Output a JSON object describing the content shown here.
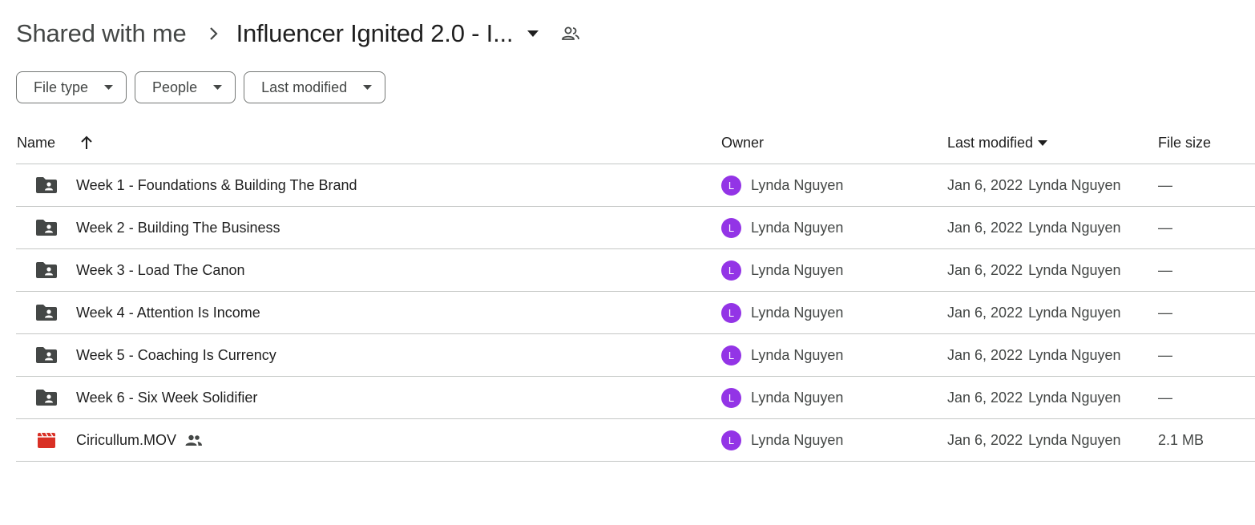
{
  "breadcrumb": {
    "root": "Shared with me",
    "current": "Influencer Ignited 2.0 - I..."
  },
  "filters": [
    {
      "label": "File type"
    },
    {
      "label": "People"
    },
    {
      "label": "Last modified"
    }
  ],
  "table": {
    "headers": {
      "name": "Name",
      "owner": "Owner",
      "last_modified": "Last modified",
      "file_size": "File size"
    },
    "rows": [
      {
        "type": "shared-folder",
        "name": "Week 1 - Foundations & Building The Brand",
        "owner_initial": "L",
        "owner": "Lynda Nguyen",
        "modified": "Jan 6, 2022",
        "modified_by": "Lynda Nguyen",
        "size": "—"
      },
      {
        "type": "shared-folder",
        "name": "Week 2 - Building The Business",
        "owner_initial": "L",
        "owner": "Lynda Nguyen",
        "modified": "Jan 6, 2022",
        "modified_by": "Lynda Nguyen",
        "size": "—"
      },
      {
        "type": "shared-folder",
        "name": "Week 3 - Load The Canon",
        "owner_initial": "L",
        "owner": "Lynda Nguyen",
        "modified": "Jan 6, 2022",
        "modified_by": "Lynda Nguyen",
        "size": "—"
      },
      {
        "type": "shared-folder",
        "name": "Week 4 - Attention Is Income",
        "owner_initial": "L",
        "owner": "Lynda Nguyen",
        "modified": "Jan 6, 2022",
        "modified_by": "Lynda Nguyen",
        "size": "—"
      },
      {
        "type": "shared-folder",
        "name": "Week 5 - Coaching Is Currency",
        "owner_initial": "L",
        "owner": "Lynda Nguyen",
        "modified": "Jan 6, 2022",
        "modified_by": "Lynda Nguyen",
        "size": "—"
      },
      {
        "type": "shared-folder",
        "name": "Week 6 - Six Week Solidifier",
        "owner_initial": "L",
        "owner": "Lynda Nguyen",
        "modified": "Jan 6, 2022",
        "modified_by": "Lynda Nguyen",
        "size": "—"
      },
      {
        "type": "video",
        "name": "Ciricullum.MOV",
        "owner_initial": "L",
        "owner": "Lynda Nguyen",
        "modified": "Jan 6, 2022",
        "modified_by": "Lynda Nguyen",
        "size": "2.1 MB"
      }
    ]
  },
  "icons": {
    "chevron": "chevron-right-icon",
    "dropdown": "arrow-drop-down-icon",
    "shared": "people-icon",
    "sort": "arrow-upward-icon",
    "folder": "shared-folder-icon",
    "video": "video-file-icon"
  },
  "colors": {
    "avatar": "#9334e6",
    "video_icon": "#d93025",
    "folder_icon": "#444746"
  }
}
